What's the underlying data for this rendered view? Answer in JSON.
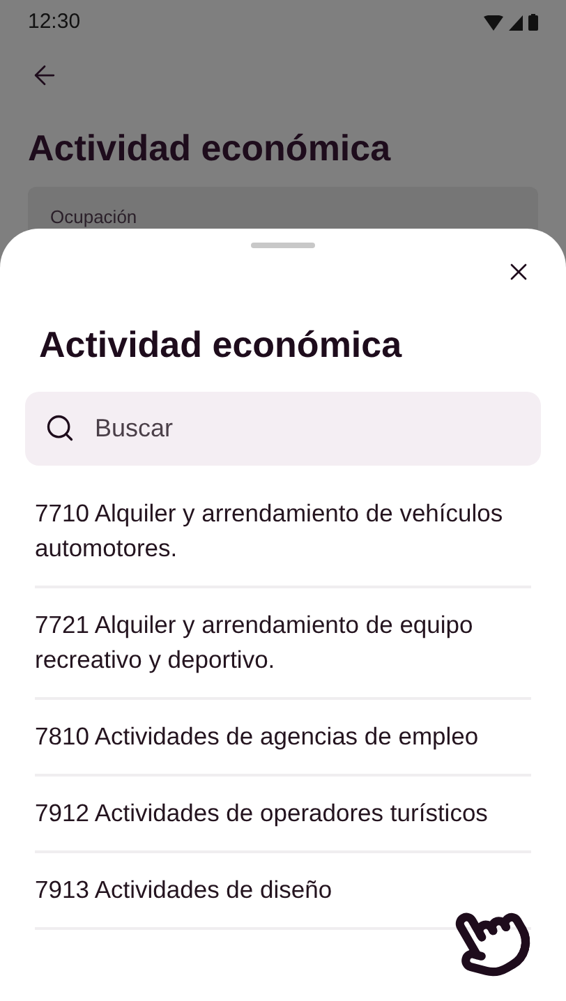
{
  "status_bar": {
    "time": "12:30"
  },
  "page": {
    "title": "Actividad económica",
    "field": {
      "label": "Ocupación"
    }
  },
  "sheet": {
    "title": "Actividad económica",
    "search": {
      "placeholder": "Buscar"
    },
    "items": [
      {
        "text": "7710 Alquiler y arrendamiento de vehículos automotores."
      },
      {
        "text": "7721 Alquiler y arrendamiento de equipo recreativo y deportivo."
      },
      {
        "text": "7810 Actividades de agencias de empleo"
      },
      {
        "text": "7912 Actividades de operadores turísticos"
      },
      {
        "text": "7913 Actividades de diseño"
      }
    ]
  }
}
